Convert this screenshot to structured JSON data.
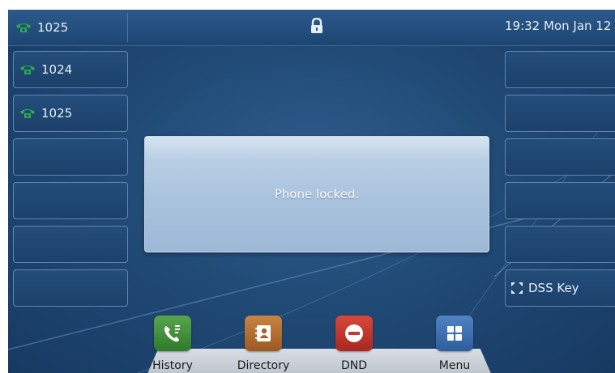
{
  "topbar": {
    "line": "1025",
    "clock": "19:32 Mon Jan 12"
  },
  "left_keys": [
    {
      "label": "1024",
      "icon": "phone-icon"
    },
    {
      "label": "1025",
      "icon": "phone-icon"
    },
    {
      "label": "",
      "icon": ""
    },
    {
      "label": "",
      "icon": ""
    },
    {
      "label": "",
      "icon": ""
    },
    {
      "label": "",
      "icon": ""
    }
  ],
  "right_keys": [
    {
      "label": ""
    },
    {
      "label": ""
    },
    {
      "label": ""
    },
    {
      "label": ""
    },
    {
      "label": ""
    },
    {
      "label": "DSS Key",
      "icon": "expand-icon"
    }
  ],
  "dialog": {
    "message": "Phone locked."
  },
  "softkeys": [
    {
      "label": "History",
      "icon": "history-icon",
      "color": "#3f8a3a"
    },
    {
      "label": "Directory",
      "icon": "directory-icon",
      "color": "#b46a2e"
    },
    {
      "label": "DND",
      "icon": "dnd-icon",
      "color": "#c43a2f"
    },
    {
      "label": "Menu",
      "icon": "menu-grid-icon",
      "color": "#3e6fae"
    }
  ],
  "colors": {
    "line_icon": "#2fae4a",
    "background": "#214a76"
  }
}
